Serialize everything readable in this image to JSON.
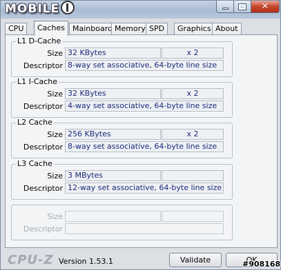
{
  "window": {
    "logo_text": "MOBILE",
    "icons": {
      "minimize": "minimize-icon",
      "maximize": "maximize-icon",
      "close": "close-icon"
    }
  },
  "tabs": [
    {
      "label": "CPU",
      "active": false
    },
    {
      "label": "Caches",
      "active": true
    },
    {
      "label": "Mainboard",
      "active": false
    },
    {
      "label": "Memory",
      "active": false
    },
    {
      "label": "SPD",
      "active": false
    },
    {
      "label": "Graphics",
      "active": false
    },
    {
      "label": "About",
      "active": false
    }
  ],
  "caches": {
    "l1d": {
      "title": "L1 D-Cache",
      "size_label": "Size",
      "size": "32 KBytes",
      "count": "x 2",
      "descriptor_label": "Descriptor",
      "descriptor": "8-way set associative, 64-byte line size"
    },
    "l1i": {
      "title": "L1 I-Cache",
      "size_label": "Size",
      "size": "32 KBytes",
      "count": "x 2",
      "descriptor_label": "Descriptor",
      "descriptor": "4-way set associative, 64-byte line size"
    },
    "l2": {
      "title": "L2 Cache",
      "size_label": "Size",
      "size": "256 KBytes",
      "count": "x 2",
      "descriptor_label": "Descriptor",
      "descriptor": "8-way set associative, 64-byte line size"
    },
    "l3": {
      "title": "L3 Cache",
      "size_label": "Size",
      "size": "3 MBytes",
      "count": "",
      "descriptor_label": "Descriptor",
      "descriptor": "12-way set associative, 64-byte line size"
    },
    "empty": {
      "size_label": "Size",
      "descriptor_label": "Descriptor"
    }
  },
  "footer": {
    "brand": "CPU-Z",
    "version": "Version 1.53.1",
    "validate_label": "Validate",
    "ok_label": "OK",
    "watermark": "#908168"
  }
}
